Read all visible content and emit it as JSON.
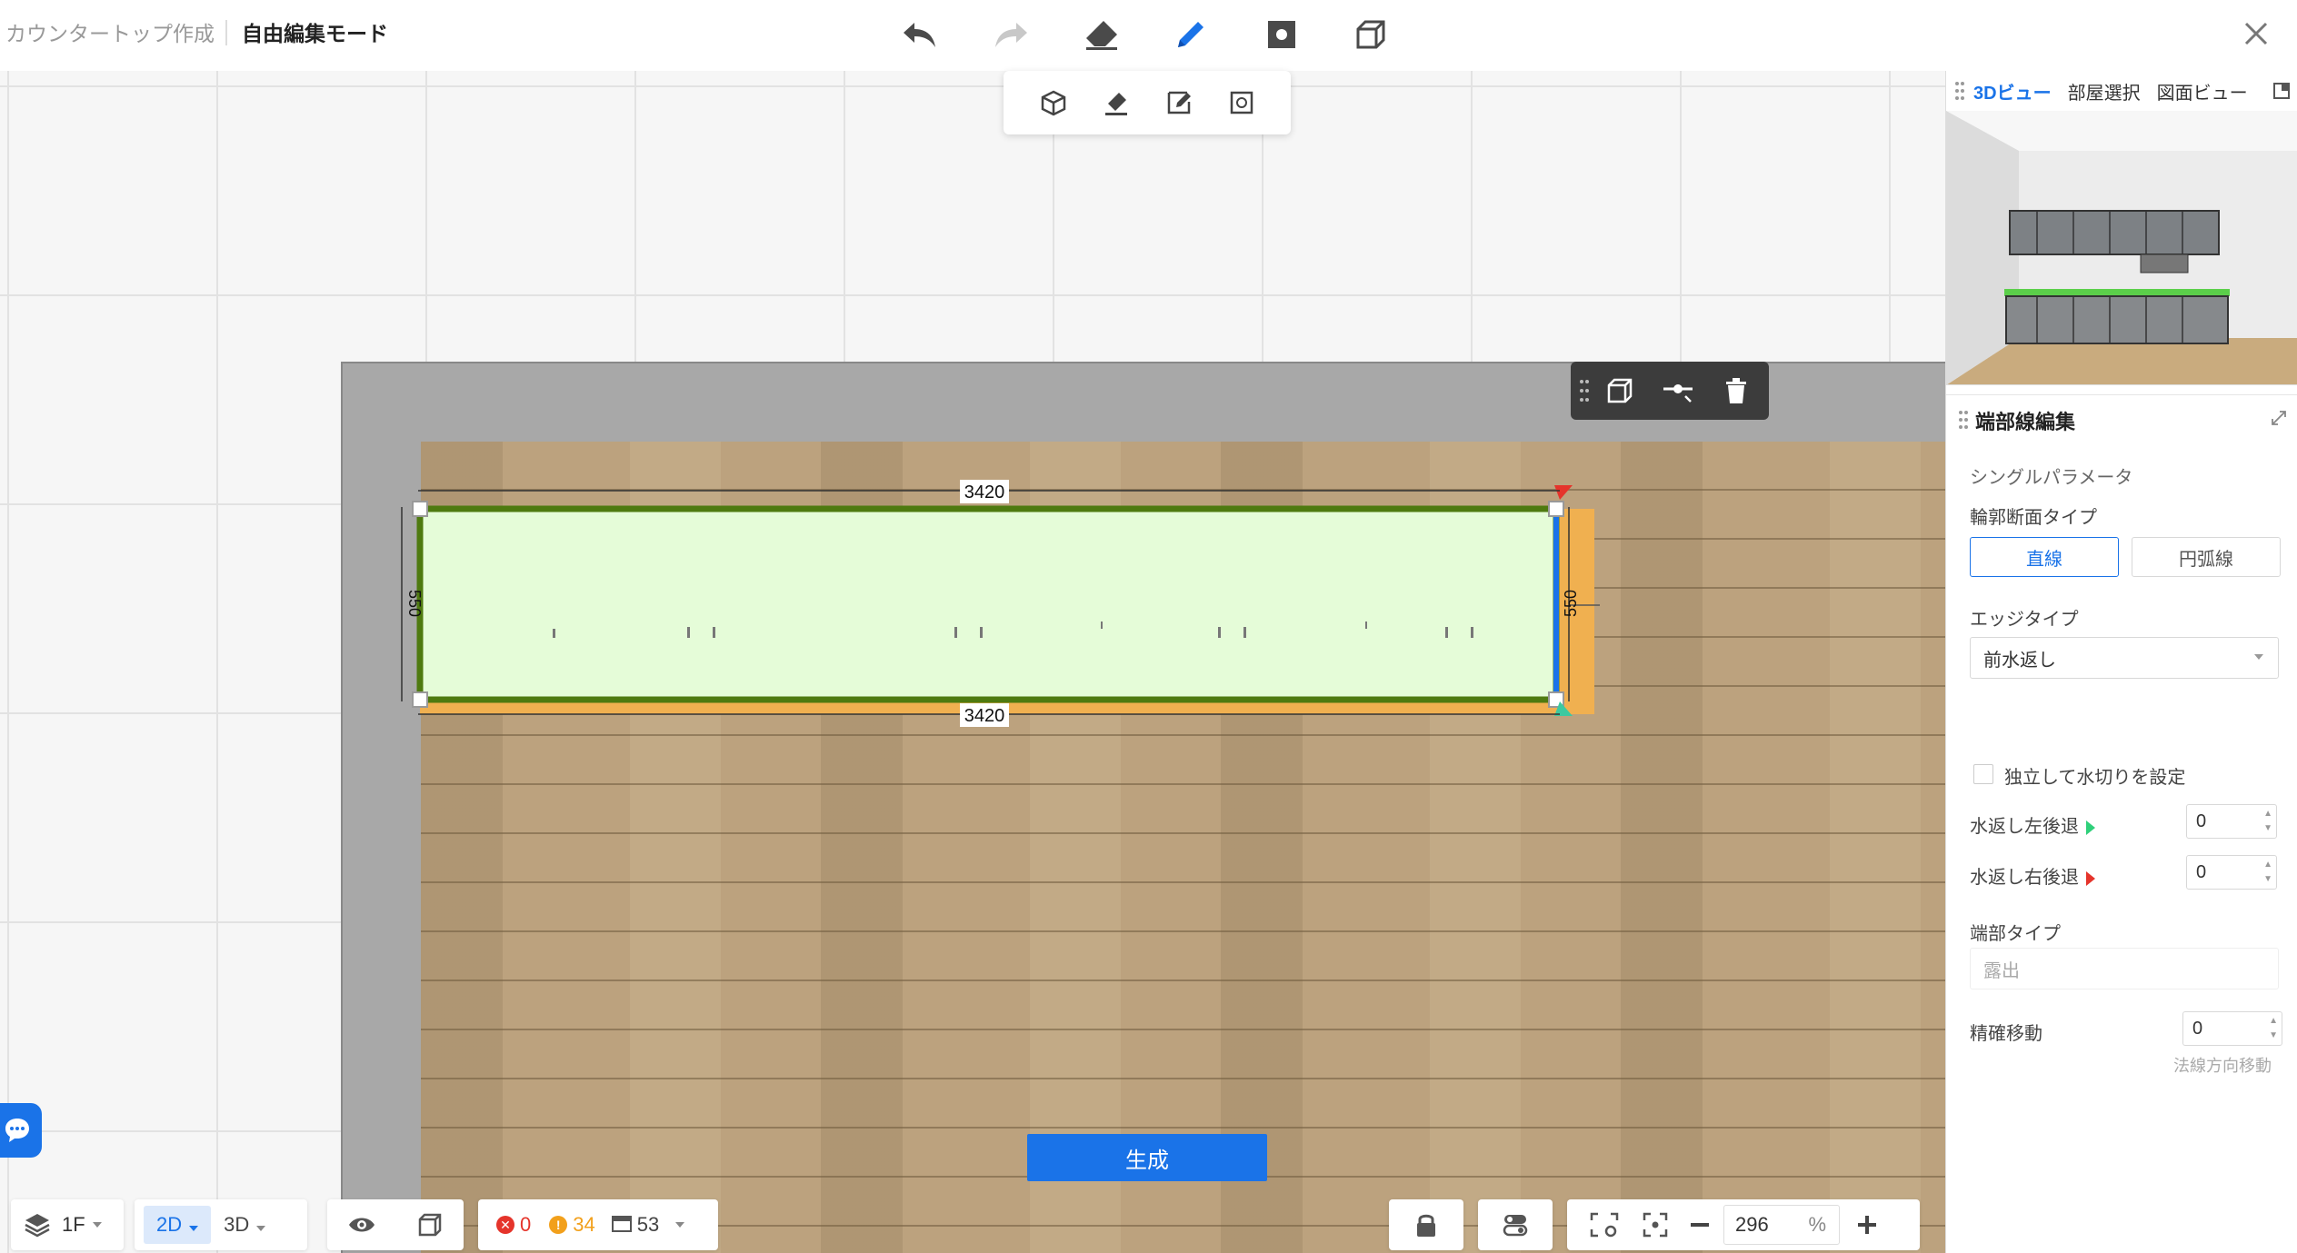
{
  "header": {
    "breadcrumb_1": "カウンタートップ作成",
    "breadcrumb_2": "自由編集モード"
  },
  "canvas": {
    "dim_top": "3420",
    "dim_bottom": "3420",
    "dim_left": "550",
    "dim_right": "550"
  },
  "generate_button": "生成",
  "right_panel": {
    "tabs": [
      "3Dビュー",
      "部屋選択",
      "図面ビュー"
    ],
    "active_tab": "3Dビュー",
    "title": "端部線編集",
    "single_param": "シングルパラメータ",
    "profile_label": "輪郭断面タイプ",
    "profile_options": [
      "直線",
      "円弧線"
    ],
    "profile_selected": "直線",
    "edge_label": "エッジタイプ",
    "edge_value": "前水返し",
    "independent_drip": "独立して水切りを設定",
    "left_back_label": "水返し左後退",
    "left_back_value": "0",
    "right_back_label": "水返し右後退",
    "right_back_value": "0",
    "end_type_label": "端部タイプ",
    "end_type_value": "露出",
    "fine_move_label": "精確移動",
    "fine_move_value": "0",
    "normal_move": "法線方向移動"
  },
  "bottom": {
    "floor": "1F",
    "view_2d": "2D",
    "view_3d": "3D",
    "errors": "0",
    "warnings": "34",
    "items": "53",
    "zoom": "296",
    "zoom_unit": "%"
  },
  "colors": {
    "accent": "#1a73e8",
    "counter_fill": "#e5fcd8",
    "counter_border": "#4e7a10",
    "error": "#e5342b",
    "warning": "#f2a01b"
  }
}
